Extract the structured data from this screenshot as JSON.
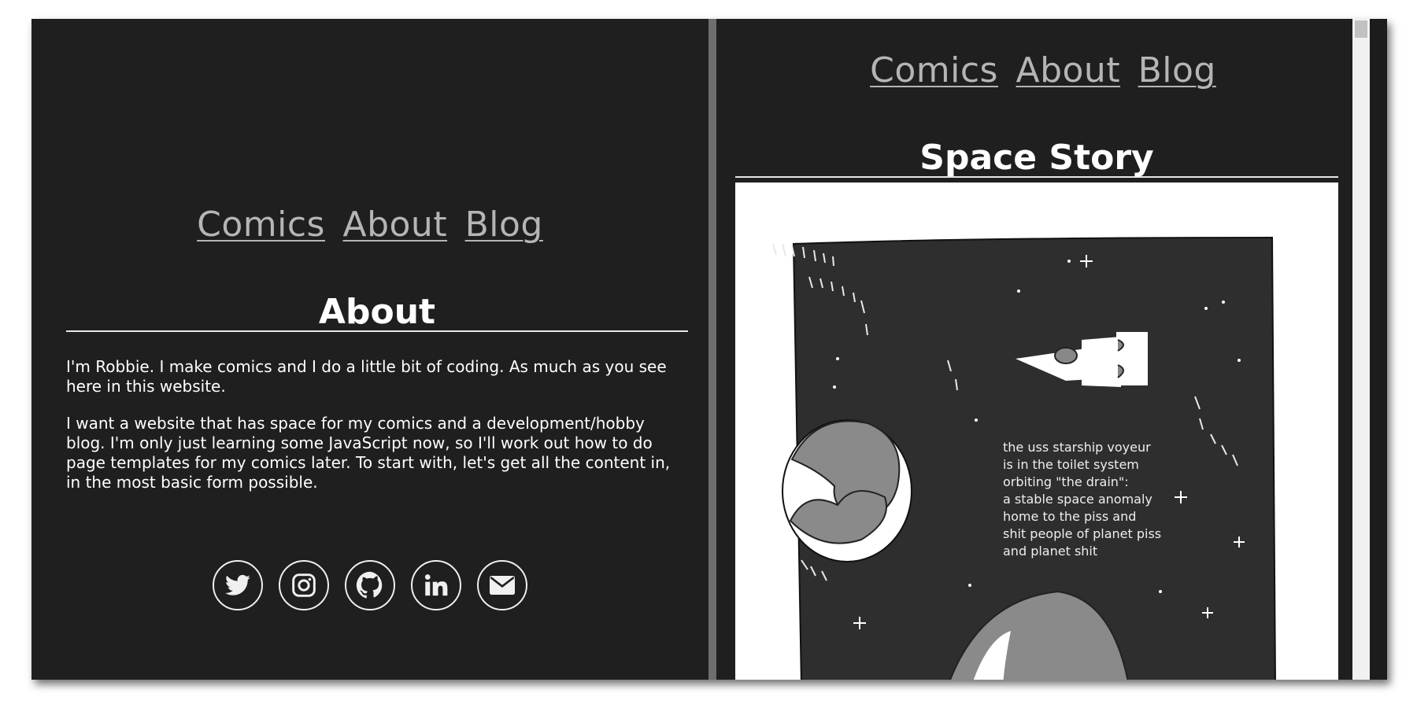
{
  "left": {
    "nav": [
      "Comics",
      "About",
      "Blog"
    ],
    "heading": "About",
    "paragraphs": [
      "I'm Robbie. I make comics and I do a little bit of coding. As much as you see here in this website.",
      "I want a website that has space for my comics and a development/hobby blog. I'm only just learning some JavaScript now, so I'll work out how to do page templates for my comics later. To start with, let's get all the content in, in the most basic form possible."
    ],
    "socials": [
      "twitter-icon",
      "instagram-icon",
      "github-icon",
      "linkedin-icon",
      "email-icon"
    ]
  },
  "right": {
    "nav": [
      "Comics",
      "About",
      "Blog"
    ],
    "heading": "Space Story",
    "caption": "the uss starship voyeur\nis in the toilet system\norbiting \"the drain\":\na stable space anomaly\nhome to the piss and\nshit people of planet piss\nand planet shit"
  }
}
